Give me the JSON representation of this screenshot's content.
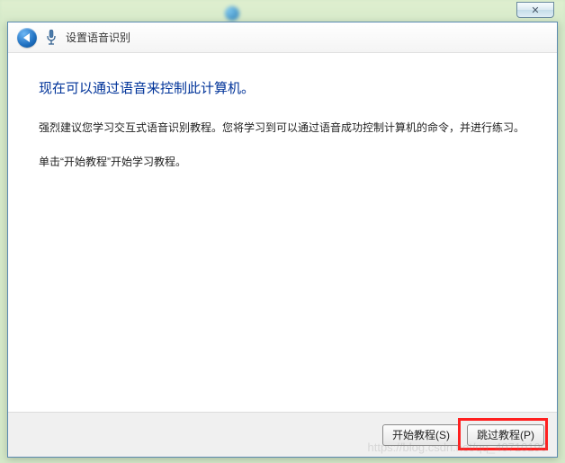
{
  "outer_close": "✕",
  "header": {
    "title": "设置语音识别"
  },
  "content": {
    "heading": "现在可以通过语音来控制此计算机。",
    "paragraph1": "强烈建议您学习交互式语音识别教程。您将学习到可以通过语音成功控制计算机的命令，并进行练习。",
    "paragraph2": "单击“开始教程”开始学习教程。"
  },
  "footer": {
    "start_label": "开始教程(S)",
    "skip_label": "跳过教程(P)"
  },
  "watermark": "https://blog.csdn.net/qq_40710190"
}
